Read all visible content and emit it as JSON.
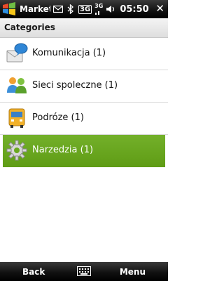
{
  "status_bar": {
    "app_title": "Market",
    "network_label": "3G",
    "signal_label": "3G",
    "time": "05:50",
    "close_label": "✕"
  },
  "header": {
    "title": "Categories"
  },
  "categories": [
    {
      "label": "Komunikacja (1)",
      "icon": "message-bubble-icon"
    },
    {
      "label": "Sieci spoleczne (1)",
      "icon": "people-icon"
    },
    {
      "label": "Podróze (1)",
      "icon": "bus-icon"
    },
    {
      "label": "Narzedzia (1)",
      "icon": "gear-icon",
      "selected": true
    }
  ],
  "softkeys": {
    "left": "Back",
    "right": "Menu"
  },
  "colors": {
    "selection": "#6aa81f",
    "bar": "#000000"
  }
}
